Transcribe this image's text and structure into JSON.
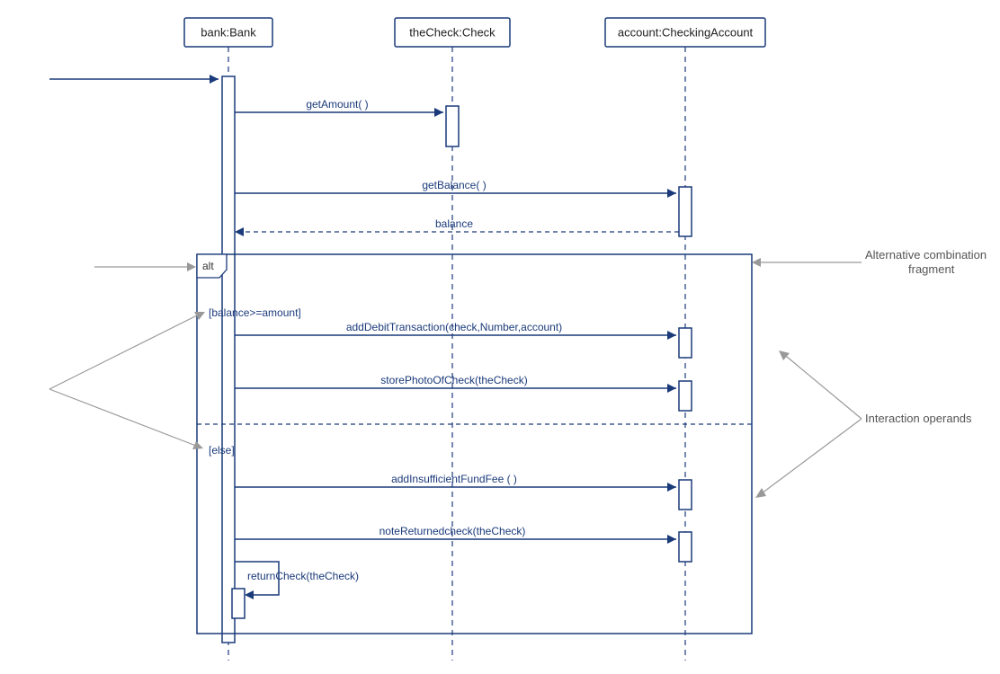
{
  "lifelines": {
    "bank": "bank:Bank",
    "check": "theCheck:Check",
    "account": "account:CheckingAccount"
  },
  "messages": {
    "getAmount": "getAmount( )",
    "getBalance": "getBalance( )",
    "balance": "balance",
    "addDebit": "addDebitTransaction(check,Number,account)",
    "storePhoto": "storePhotoOfCheck(theCheck)",
    "addInsuf": "addInsufficientFundFee ( )",
    "noteReturned": "noteReturnedcheck(theCheck)",
    "returnCheck": "returnCheck(theCheck)"
  },
  "guards": {
    "balanceGe": "[balance>=amount]",
    "else": "[else]"
  },
  "fragments": {
    "alt": "alt"
  },
  "annotations": {
    "altFrag1": "Alternative combination",
    "altFrag2": "fragment",
    "interOp": "Interaction operands"
  },
  "chart_data": {
    "type": "uml-sequence-diagram",
    "title": "",
    "lifelines": [
      {
        "id": "bank",
        "label": "bank:Bank"
      },
      {
        "id": "check",
        "label": "theCheck:Check"
      },
      {
        "id": "account",
        "label": "account:CheckingAccount"
      }
    ],
    "found_message_into": "bank",
    "activations": [
      {
        "lifeline": "bank",
        "main": true
      },
      {
        "lifeline": "check",
        "during": "getAmount"
      },
      {
        "lifeline": "account",
        "during": [
          "getBalance",
          "balance"
        ]
      },
      {
        "lifeline": "account",
        "during": "addDebitTransaction"
      },
      {
        "lifeline": "account",
        "during": "storePhotoOfCheck"
      },
      {
        "lifeline": "account",
        "during": "addInsufficientFundFee"
      },
      {
        "lifeline": "account",
        "during": "noteReturnedcheck"
      },
      {
        "lifeline": "bank",
        "nested": true,
        "during": "returnCheck"
      }
    ],
    "messages": [
      {
        "from": "bank",
        "to": "check",
        "label": "getAmount( )",
        "type": "sync"
      },
      {
        "from": "bank",
        "to": "account",
        "label": "getBalance( )",
        "type": "sync"
      },
      {
        "from": "account",
        "to": "bank",
        "label": "balance",
        "type": "return"
      },
      {
        "from": "bank",
        "to": "account",
        "label": "addDebitTransaction(check,Number,account)",
        "type": "sync",
        "operand": 0
      },
      {
        "from": "bank",
        "to": "account",
        "label": "storePhotoOfCheck(theCheck)",
        "type": "sync",
        "operand": 0
      },
      {
        "from": "bank",
        "to": "account",
        "label": "addInsufficientFundFee ( )",
        "type": "sync",
        "operand": 1
      },
      {
        "from": "bank",
        "to": "account",
        "label": "noteReturnedcheck(theCheck)",
        "type": "sync",
        "operand": 1
      },
      {
        "from": "bank",
        "to": "bank",
        "label": "returnCheck(theCheck)",
        "type": "self",
        "operand": 1
      }
    ],
    "combined_fragments": [
      {
        "operator": "alt",
        "covers": [
          "bank",
          "check",
          "account"
        ],
        "operands": [
          {
            "guard": "[balance>=amount]"
          },
          {
            "guard": "[else]"
          }
        ]
      }
    ],
    "annotations": [
      {
        "text": "Alternative combination fragment",
        "points_to": "alt-fragment-box"
      },
      {
        "text": "Interaction operands",
        "points_to": "alt-operands"
      }
    ]
  }
}
